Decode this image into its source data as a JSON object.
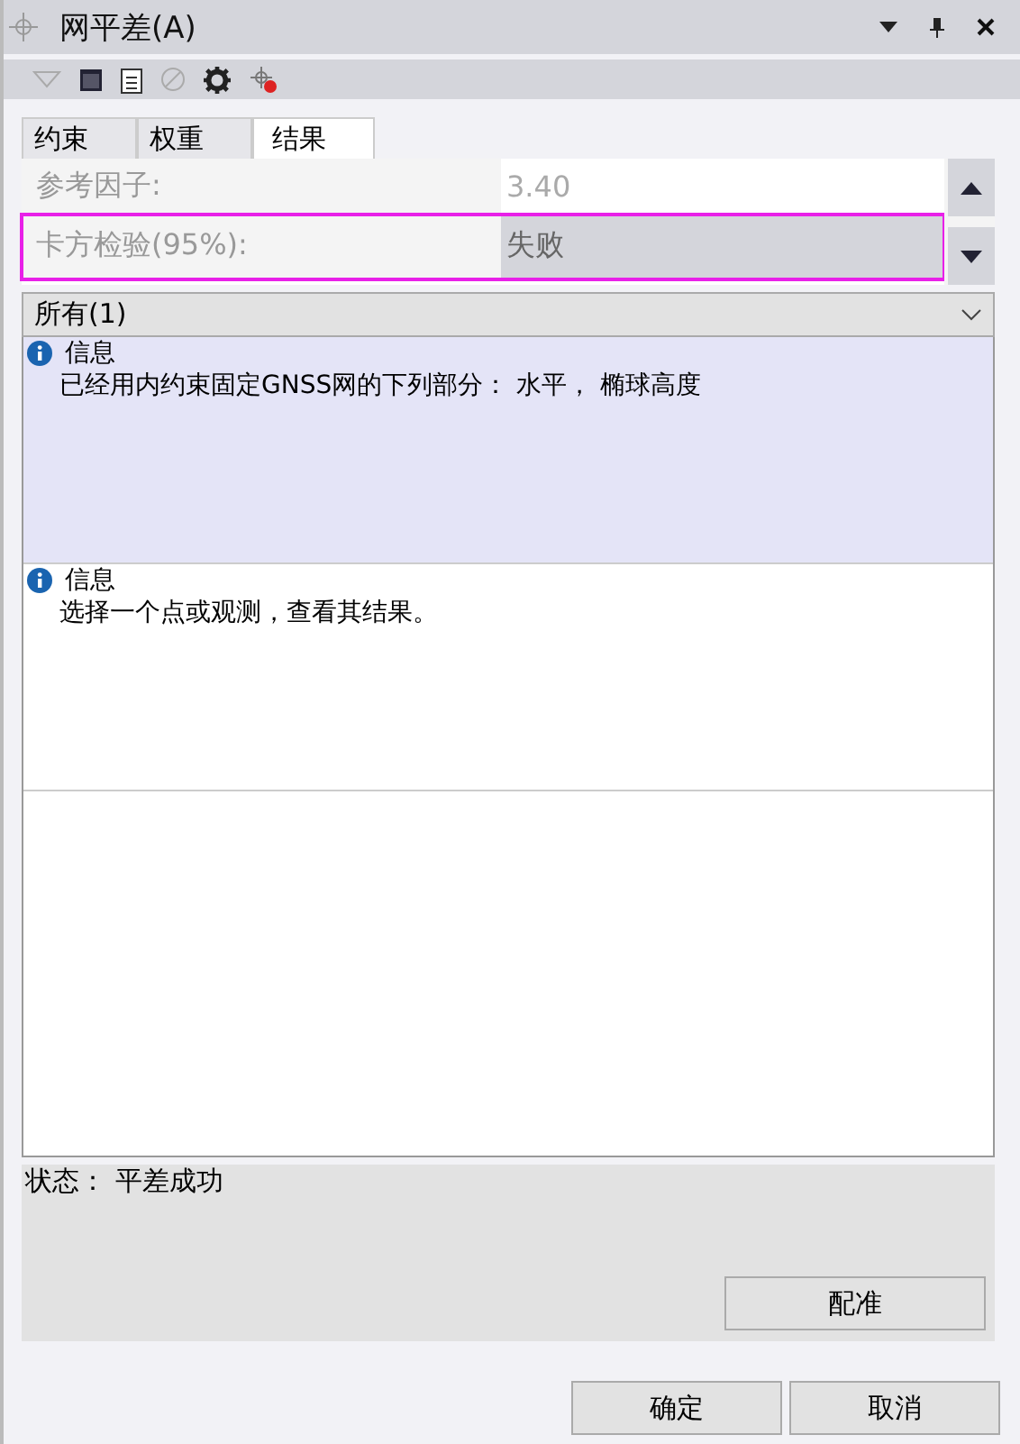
{
  "window": {
    "title": "网平差(A)"
  },
  "tabs": [
    {
      "label": "约束",
      "selected": false
    },
    {
      "label": "权重",
      "selected": false
    },
    {
      "label": "结果",
      "selected": true
    }
  ],
  "properties": [
    {
      "label": "参考因子:",
      "value": "3.40",
      "selected": false,
      "highlighted": false
    },
    {
      "label": "卡方检验(95%):",
      "value": "失败",
      "selected": true,
      "highlighted": true
    }
  ],
  "filter": {
    "value": "所有(1)"
  },
  "messages": [
    {
      "title": "信息",
      "text": "已经用内约束固定GNSS网的下列部分：  水平， 椭球高度",
      "selected": true
    },
    {
      "title": "信息",
      "text": "选择一个点或观测，查看其结果。",
      "selected": false
    }
  ],
  "status": "状态：  平差成功",
  "register_button": "配准",
  "buttons": [
    {
      "label": "确定"
    },
    {
      "label": "取消"
    }
  ]
}
